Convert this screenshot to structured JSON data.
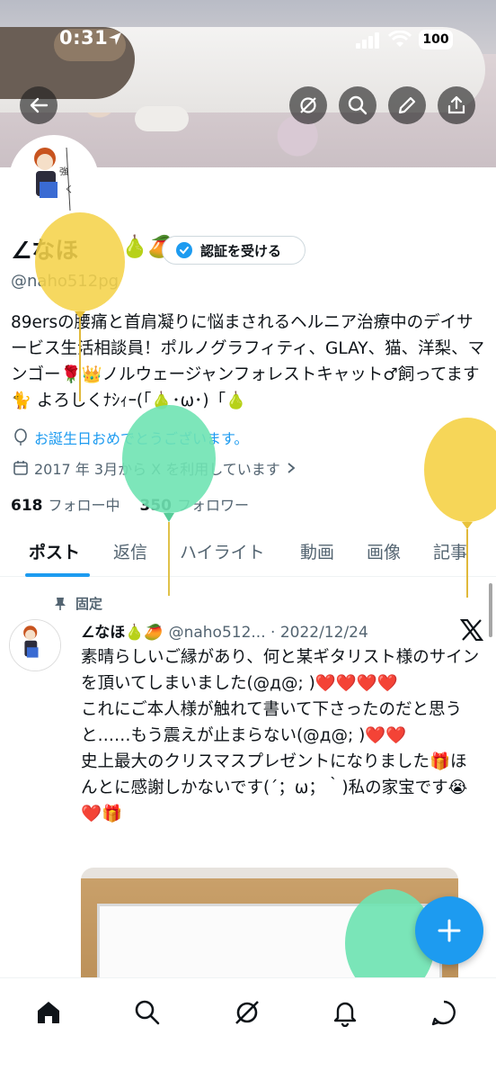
{
  "status_bar": {
    "time": "0:31",
    "battery": "100"
  },
  "banner_buttons": {
    "back_icon": "arrow-left-icon",
    "grok_icon": "slash-circle-icon",
    "search_icon": "search-icon",
    "edit_icon": "pencil-icon",
    "share_icon": "share-icon"
  },
  "profile": {
    "name": "∠なほ",
    "name_emoji": "🍐🥭",
    "verify_label": "認証を受ける",
    "handle": "@naho512pg",
    "bio": "89ersの腰痛と首肩凝りに悩まされるヘルニア治療中のデイサービス生活相談員！ポルノグラフィティ、GLAY、猫、洋梨、マンゴー🌹👑ノルウェージャンフォレストキャット♂飼ってます🐈 よろしくﾅｼｨｰ(「🍐･ω･)「🍐",
    "birthday": "お誕生日おめでとうございます。",
    "joined": "2017 年 3月から X を利用しています",
    "following_count": "618",
    "following_label": "フォロー中",
    "followers_count": "350",
    "followers_label": "フォロワー"
  },
  "tabs": [
    {
      "label": "ポスト"
    },
    {
      "label": "返信"
    },
    {
      "label": "ハイライト"
    },
    {
      "label": "動画"
    },
    {
      "label": "画像"
    },
    {
      "label": "記事"
    }
  ],
  "pinned_post": {
    "pinned_label": "固定",
    "author_name": "∠なほ🍐🥭",
    "author_meta": "@naho512... · 2022/12/24",
    "body": "素晴らしいご縁があり、何と某ギタリスト様のサインを頂いてしまいました(@д@; )❤️❤️❤️❤️\nこれにご本人様が触れて書いて下さったのだと思うと……もう震えが止まらない(@д@; )❤️❤️\n史上最大のクリスマスプレゼントになりました🎁ほんとに感謝しかないです(´；ω；｀)私の家宝です😭❤️🎁"
  },
  "fab": {
    "icon": "plus-icon"
  },
  "bottom_nav": {
    "items": [
      "home-icon",
      "search-icon",
      "grok-icon",
      "bell-icon",
      "messages-icon"
    ]
  },
  "colors": {
    "accent": "#1d9bf0",
    "balloon_yellow": "#f5d34a",
    "balloon_green": "#6fe3b2"
  }
}
